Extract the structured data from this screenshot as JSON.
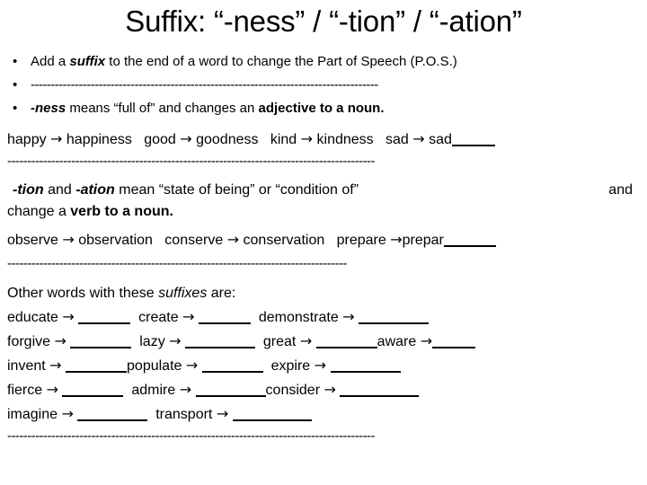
{
  "slide": {
    "title": "Suffix: “-ness” / “-tion” / “-ation”",
    "bullets": [
      {
        "marker": "•",
        "segments": [
          {
            "text": "Add a ",
            "style": "normal"
          },
          {
            "text": "suffix",
            "style": "bold-italic"
          },
          {
            "text": " to the end of a word to change the Part of Speech (P.O.S.)",
            "style": "normal"
          }
        ]
      },
      {
        "marker": "•",
        "rule": "---------------------------------------------------------------------------------------"
      },
      {
        "marker": "•",
        "segments": [
          {
            "text": "-ness",
            "style": "bold-italic"
          },
          {
            "text": " means “full of” and changes an ",
            "style": "normal"
          },
          {
            "text": "adjective to a noun.",
            "style": "bold"
          }
        ]
      }
    ],
    "ness_examples": [
      {
        "word": "happy",
        "arrow": "→",
        "result": "happiness",
        "blank": false
      },
      {
        "word": "good",
        "arrow": "→",
        "result": "goodness",
        "blank": false
      },
      {
        "word": "kind",
        "arrow": "→",
        "result": "kindness",
        "blank": false
      },
      {
        "word": "sad",
        "arrow": "→",
        "result": "sad",
        "blank": true
      }
    ],
    "rule_2": "--------------------------------------------------------------------------------------------",
    "tion_definition": {
      "segments": [
        {
          "text": "-tion",
          "style": "bold-italic"
        },
        {
          "text": "  and  ",
          "style": "normal"
        },
        {
          "text": "-ation",
          "style": "bold-italic"
        },
        {
          "text": "  mean “state of being” or “condition of”",
          "style": "normal"
        }
      ],
      "trailing_right": "and"
    },
    "tion_definition_line2": [
      {
        "text": "change a ",
        "style": "normal"
      },
      {
        "text": "verb to a noun.",
        "style": "bold"
      }
    ],
    "tion_examples": [
      {
        "word": "observe",
        "arrow": "→",
        "result": "observation",
        "blank": false
      },
      {
        "word": "conserve",
        "arrow": "→",
        "result": "conservation",
        "blank": false
      },
      {
        "word": "prepare",
        "arrow": "→",
        "result": "prepar",
        "blank": true
      }
    ],
    "rule_3": " -------------------------------------------------------------------------------------",
    "other_words_intro": [
      {
        "text": "Other words with these ",
        "style": "normal"
      },
      {
        "text": "suffixes",
        "style": "italic"
      },
      {
        "text": " are:",
        "style": "normal"
      }
    ],
    "exercise_rows": [
      [
        {
          "word": "educate",
          "arrow": "→",
          "blank_size": 6
        },
        {
          "word": "create",
          "arrow": "→",
          "blank_size": 6
        },
        {
          "word": "demonstrate",
          "arrow": "→",
          "blank_size": 8
        }
      ],
      [
        {
          "word": "forgive",
          "arrow": "→",
          "blank_size": 7
        },
        {
          "word": "lazy",
          "arrow": "→",
          "blank_size": 8
        },
        {
          "word": "great",
          "arrow": "→",
          "blank_size": 7
        },
        {
          "word": "aware",
          "arrow": "→",
          "blank_size": 5
        }
      ],
      [
        {
          "word": "invent",
          "arrow": "→",
          "blank_size": 7
        },
        {
          "word": "populate",
          "arrow": "→",
          "blank_size": 7
        },
        {
          "word": "expire",
          "arrow": "→",
          "blank_size": 8
        }
      ],
      [
        {
          "word": "fierce",
          "arrow": "→",
          "blank_size": 7
        },
        {
          "word": "admire",
          "arrow": "→",
          "blank_size": 8
        },
        {
          "word": "consider",
          "arrow": "→",
          "blank_size": 9
        }
      ],
      [
        {
          "word": "imagine",
          "arrow": "→",
          "blank_size": 8
        },
        {
          "word": "transport",
          "arrow": "→",
          "blank_size": 9
        }
      ]
    ],
    "rule_4": "--------------------------------------------------------------------------------------------",
    "colors": {
      "text": "#000000",
      "background": "#ffffff"
    }
  }
}
